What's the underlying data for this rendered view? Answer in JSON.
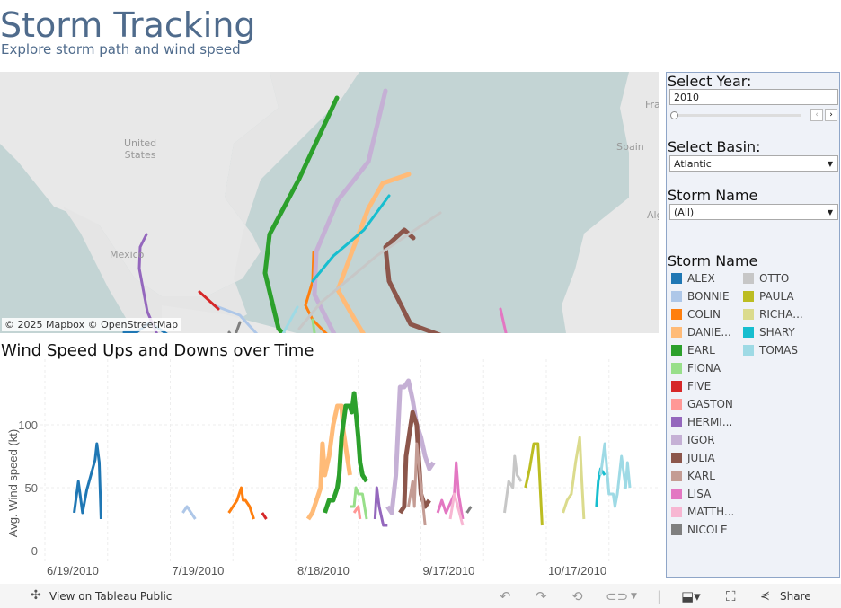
{
  "header": {
    "title": "Storm Tracking",
    "subtitle": "Explore storm path and wind speed"
  },
  "map": {
    "attribution": "© 2025 Mapbox  © OpenStreetMap",
    "labels": {
      "us": "United\nStates",
      "mexico": "Mexico",
      "spain": "Spain",
      "france": "Fra",
      "algeria": "Alg"
    }
  },
  "controls": {
    "year_label": "Select Year:",
    "year_value": "2010",
    "basin_label": "Select Basin:",
    "basin_value": "Atlantic",
    "storm_label": "Storm Name",
    "storm_value": "(All)",
    "slider_position": 0
  },
  "legend": {
    "title": "Storm Name",
    "items": [
      {
        "name": "ALEX",
        "color": "#1f77b4"
      },
      {
        "name": "BONNIE",
        "color": "#aec7e8"
      },
      {
        "name": "COLIN",
        "color": "#ff7f0e"
      },
      {
        "name": "DANIE...",
        "color": "#ffbb78"
      },
      {
        "name": "EARL",
        "color": "#2ca02c"
      },
      {
        "name": "FIONA",
        "color": "#98df8a"
      },
      {
        "name": "FIVE",
        "color": "#d62728"
      },
      {
        "name": "GASTON",
        "color": "#ff9896"
      },
      {
        "name": "HERMI...",
        "color": "#9467bd"
      },
      {
        "name": "IGOR",
        "color": "#c5b0d5"
      },
      {
        "name": "JULIA",
        "color": "#8c564b"
      },
      {
        "name": "KARL",
        "color": "#c49c94"
      },
      {
        "name": "LISA",
        "color": "#e377c2"
      },
      {
        "name": "MATTH...",
        "color": "#f7b6d2"
      },
      {
        "name": "NICOLE",
        "color": "#7f7f7f"
      },
      {
        "name": "OTTO",
        "color": "#c7c7c7"
      },
      {
        "name": "PAULA",
        "color": "#bcbd22"
      },
      {
        "name": "RICHA...",
        "color": "#dbdb8d"
      },
      {
        "name": "SHARY",
        "color": "#17becf"
      },
      {
        "name": "TOMAS",
        "color": "#9edae5"
      }
    ]
  },
  "chart_data": {
    "type": "line",
    "title": "Wind Speed Ups and Downs over Time",
    "xlabel": "",
    "ylabel": "Avg. Wind speed (kt)",
    "x_ticks": [
      "6/19/2010",
      "7/19/2010",
      "8/18/2010",
      "9/17/2010",
      "10/17/2010"
    ],
    "y_ticks": [
      0,
      50,
      100
    ],
    "ylim": [
      0,
      140
    ],
    "xlim": [
      "2010-06-19",
      "2010-11-10"
    ],
    "grid": true,
    "series": [
      {
        "name": "ALEX",
        "color": "#1f77b4",
        "points": [
          [
            "2010-06-26",
            30
          ],
          [
            "2010-06-27",
            55
          ],
          [
            "2010-06-28",
            30
          ],
          [
            "2010-06-29",
            48
          ],
          [
            "2010-06-30",
            60
          ],
          [
            "2010-07-01",
            72
          ],
          [
            "2010-07-01",
            85
          ],
          [
            "2010-07-02",
            70
          ],
          [
            "2010-07-02",
            25
          ]
        ]
      },
      {
        "name": "BONNIE",
        "color": "#aec7e8",
        "points": [
          [
            "2010-07-22",
            30
          ],
          [
            "2010-07-23",
            35
          ],
          [
            "2010-07-24",
            30
          ],
          [
            "2010-07-25",
            25
          ]
        ]
      },
      {
        "name": "COLIN",
        "color": "#ff7f0e",
        "points": [
          [
            "2010-08-02",
            30
          ],
          [
            "2010-08-03",
            35
          ],
          [
            "2010-08-04",
            40
          ],
          [
            "2010-08-05",
            50
          ],
          [
            "2010-08-05",
            40
          ],
          [
            "2010-08-06",
            40
          ],
          [
            "2010-08-07",
            35
          ],
          [
            "2010-08-08",
            25
          ]
        ]
      },
      {
        "name": "FIVE",
        "color": "#d62728",
        "points": [
          [
            "2010-08-10",
            30
          ],
          [
            "2010-08-11",
            25
          ]
        ]
      },
      {
        "name": "DANIELLE",
        "color": "#ffbb78",
        "points": [
          [
            "2010-08-21",
            25
          ],
          [
            "2010-08-22",
            30
          ],
          [
            "2010-08-24",
            50
          ],
          [
            "2010-08-24",
            85
          ],
          [
            "2010-08-25",
            60
          ],
          [
            "2010-08-26",
            75
          ],
          [
            "2010-08-27",
            100
          ],
          [
            "2010-08-28",
            115
          ],
          [
            "2010-08-29",
            115
          ],
          [
            "2010-08-29",
            95
          ],
          [
            "2010-08-31",
            60
          ]
        ]
      },
      {
        "name": "EARL",
        "color": "#2ca02c",
        "points": [
          [
            "2010-08-25",
            30
          ],
          [
            "2010-08-26",
            40
          ],
          [
            "2010-08-27",
            40
          ],
          [
            "2010-08-28",
            50
          ],
          [
            "2010-08-28",
            60
          ],
          [
            "2010-08-29",
            90
          ],
          [
            "2010-08-30",
            115
          ],
          [
            "2010-08-31",
            115
          ],
          [
            "2010-08-31",
            110
          ],
          [
            "2010-09-01",
            125
          ],
          [
            "2010-09-02",
            90
          ],
          [
            "2010-09-02",
            70
          ],
          [
            "2010-09-03",
            60
          ],
          [
            "2010-09-04",
            55
          ]
        ]
      },
      {
        "name": "FIONA",
        "color": "#98df8a",
        "points": [
          [
            "2010-08-31",
            35
          ],
          [
            "2010-09-01",
            35
          ],
          [
            "2010-09-01",
            50
          ],
          [
            "2010-09-02",
            45
          ],
          [
            "2010-09-03",
            45
          ],
          [
            "2010-09-04",
            25
          ]
        ]
      },
      {
        "name": "GASTON",
        "color": "#ff9896",
        "points": [
          [
            "2010-09-01",
            30
          ],
          [
            "2010-09-02",
            35
          ],
          [
            "2010-09-02",
            25
          ]
        ]
      },
      {
        "name": "HERMINE",
        "color": "#9467bd",
        "points": [
          [
            "2010-09-06",
            25
          ],
          [
            "2010-09-06",
            50
          ],
          [
            "2010-09-07",
            35
          ],
          [
            "2010-09-08",
            20
          ],
          [
            "2010-09-09",
            20
          ]
        ]
      },
      {
        "name": "IGOR",
        "color": "#c5b0d5",
        "points": [
          [
            "2010-09-09",
            35
          ],
          [
            "2010-09-10",
            30
          ],
          [
            "2010-09-11",
            60
          ],
          [
            "2010-09-12",
            130
          ],
          [
            "2010-09-13",
            130
          ],
          [
            "2010-09-14",
            135
          ],
          [
            "2010-09-15",
            120
          ],
          [
            "2010-09-16",
            100
          ],
          [
            "2010-09-17",
            90
          ],
          [
            "2010-09-18",
            75
          ],
          [
            "2010-09-19",
            65
          ],
          [
            "2010-09-20",
            70
          ]
        ]
      },
      {
        "name": "JULIA",
        "color": "#8c564b",
        "points": [
          [
            "2010-09-12",
            30
          ],
          [
            "2010-09-13",
            35
          ],
          [
            "2010-09-13",
            75
          ],
          [
            "2010-09-15",
            110
          ],
          [
            "2010-09-16",
            100
          ],
          [
            "2010-09-16",
            75
          ],
          [
            "2010-09-17",
            45
          ],
          [
            "2010-09-18",
            35
          ],
          [
            "2010-09-19",
            40
          ]
        ]
      },
      {
        "name": "KARL",
        "color": "#c49c94",
        "points": [
          [
            "2010-09-14",
            35
          ],
          [
            "2010-09-15",
            55
          ],
          [
            "2010-09-15",
            35
          ],
          [
            "2010-09-16",
            85
          ],
          [
            "2010-09-18",
            20
          ]
        ]
      },
      {
        "name": "LISA",
        "color": "#e377c2",
        "points": [
          [
            "2010-09-21",
            30
          ],
          [
            "2010-09-22",
            40
          ],
          [
            "2010-09-23",
            30
          ],
          [
            "2010-09-25",
            45
          ],
          [
            "2010-09-25",
            70
          ],
          [
            "2010-09-26",
            45
          ],
          [
            "2010-09-27",
            25
          ]
        ]
      },
      {
        "name": "MATTHEW",
        "color": "#f7b6d2",
        "points": [
          [
            "2010-09-24",
            25
          ],
          [
            "2010-09-25",
            45
          ],
          [
            "2010-09-27",
            20
          ]
        ]
      },
      {
        "name": "NICOLE",
        "color": "#7f7f7f",
        "points": [
          [
            "2010-09-28",
            30
          ],
          [
            "2010-09-29",
            35
          ]
        ]
      },
      {
        "name": "OTTO",
        "color": "#c7c7c7",
        "points": [
          [
            "2010-10-07",
            30
          ],
          [
            "2010-10-08",
            55
          ],
          [
            "2010-10-09",
            50
          ],
          [
            "2010-10-09",
            75
          ],
          [
            "2010-10-10",
            60
          ],
          [
            "2010-10-11",
            55
          ]
        ]
      },
      {
        "name": "PAULA",
        "color": "#bcbd22",
        "points": [
          [
            "2010-10-12",
            50
          ],
          [
            "2010-10-13",
            65
          ],
          [
            "2010-10-14",
            85
          ],
          [
            "2010-10-15",
            85
          ],
          [
            "2010-10-16",
            20
          ]
        ]
      },
      {
        "name": "RICHARD",
        "color": "#dbdb8d",
        "points": [
          [
            "2010-10-21",
            30
          ],
          [
            "2010-10-22",
            40
          ],
          [
            "2010-10-23",
            45
          ],
          [
            "2010-10-24",
            70
          ],
          [
            "2010-10-25",
            90
          ],
          [
            "2010-10-25",
            60
          ],
          [
            "2010-10-26",
            25
          ]
        ]
      },
      {
        "name": "SHARY",
        "color": "#17becf",
        "points": [
          [
            "2010-10-29",
            35
          ],
          [
            "2010-10-29",
            55
          ],
          [
            "2010-10-30",
            65
          ],
          [
            "2010-10-31",
            60
          ]
        ]
      },
      {
        "name": "TOMAS",
        "color": "#9edae5",
        "points": [
          [
            "2010-10-30",
            60
          ],
          [
            "2010-10-31",
            85
          ],
          [
            "2010-11-01",
            45
          ],
          [
            "2010-11-02",
            45
          ],
          [
            "2010-11-02",
            35
          ],
          [
            "2010-11-03",
            45
          ],
          [
            "2010-11-04",
            75
          ],
          [
            "2010-11-05",
            50
          ],
          [
            "2010-11-05",
            70
          ],
          [
            "2010-11-06",
            50
          ]
        ]
      }
    ]
  },
  "toolbar": {
    "view_label": "View on Tableau Public",
    "share_label": "Share"
  }
}
